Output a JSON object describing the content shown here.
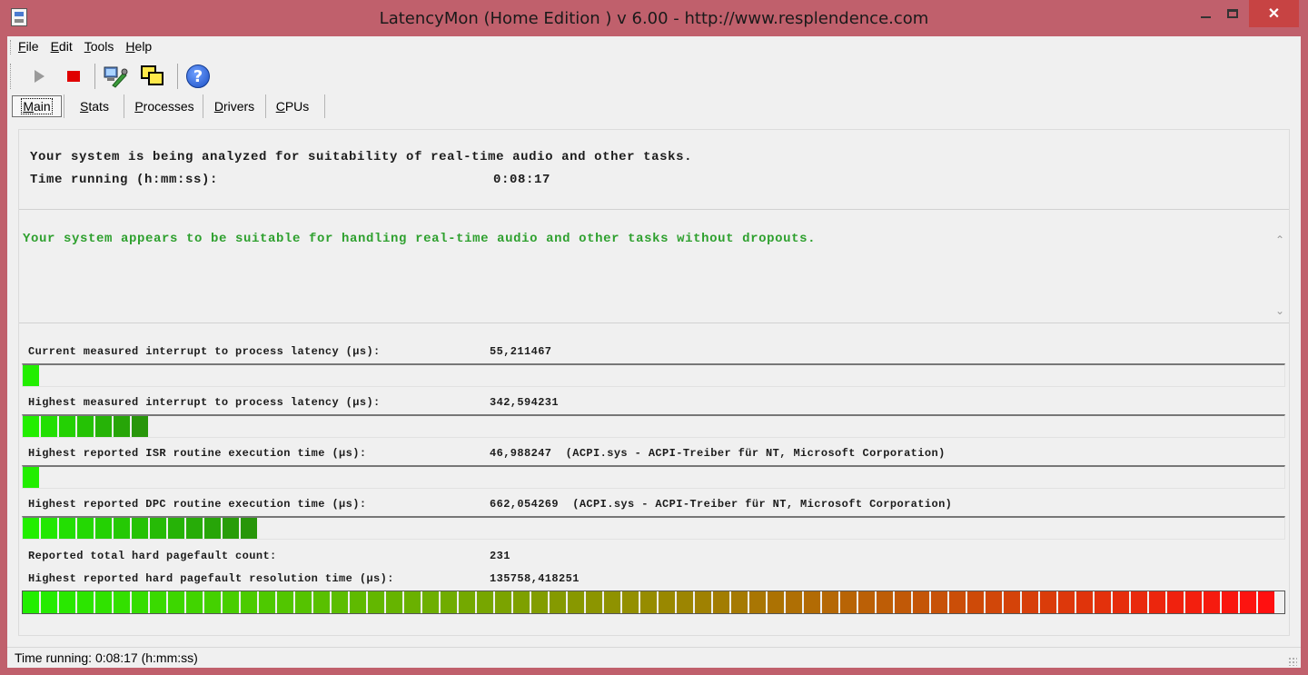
{
  "window": {
    "title": "LatencyMon  (Home Edition )  v 6.00 - http://www.resplendence.com",
    "close_glyph": "✕"
  },
  "menu": [
    {
      "underline": "F",
      "rest": "ile"
    },
    {
      "underline": "E",
      "rest": "dit"
    },
    {
      "underline": "T",
      "rest": "ools"
    },
    {
      "underline": "H",
      "rest": "elp"
    }
  ],
  "toolbar": {
    "help_glyph": "?"
  },
  "tabs": [
    {
      "underline": "M",
      "rest": "ain"
    },
    {
      "underline": "S",
      "rest": "tats"
    },
    {
      "underline": "P",
      "rest": "rocesses"
    },
    {
      "underline": "D",
      "rest": "rivers"
    },
    {
      "underline": "C",
      "rest": "PUs"
    }
  ],
  "main": {
    "header": "Your system is being analyzed for suitability of real-time audio and other tasks.",
    "time_label": "Time running (h:mm:ss):",
    "time_value": "0:08:17",
    "verdict": "Your system appears to be suitable for handling real-time audio and other tasks without dropouts.",
    "verdict_color": "#2ea02e",
    "metrics": {
      "current_latency_label": "Current measured interrupt to process latency (µs):",
      "current_latency_value": "55,211467",
      "current_latency_level": 0.013,
      "highest_latency_label": "Highest measured interrupt to process latency (µs):",
      "highest_latency_value": "342,594231",
      "highest_latency_level": 0.1,
      "isr_label": "Highest reported ISR routine execution time (µs):",
      "isr_value": "46,988247  (ACPI.sys - ACPI-Treiber für NT, Microsoft Corporation)",
      "isr_level": 0.013,
      "dpc_label": "Highest reported DPC routine execution time (µs):",
      "dpc_value": "662,054269  (ACPI.sys - ACPI-Treiber für NT, Microsoft Corporation)",
      "dpc_level": 0.186,
      "pagefault_count_label": "Reported total hard pagefault count:",
      "pagefault_count_value": "231",
      "pagefault_time_label": "Highest reported hard pagefault resolution time (µs):",
      "pagefault_time_value": "135758,418251",
      "pagefault_time_level": 1.0
    }
  },
  "status": {
    "text": "Time running: 0:08:17  (h:mm:ss)"
  },
  "colors": {
    "title_bar": "#c0606c",
    "bar_green": "#22ee00",
    "bar_red": "#ff1010"
  }
}
